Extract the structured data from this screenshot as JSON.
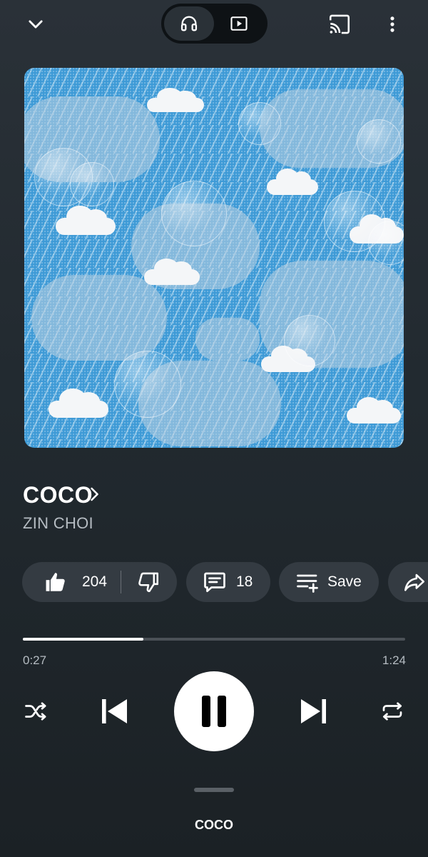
{
  "top_bar": {
    "minimize_icon": "chevron-down-icon",
    "mode_audio_icon": "headphones-icon",
    "mode_video_icon": "video-play-icon",
    "cast_icon": "cast-icon",
    "more_icon": "more-vertical-icon"
  },
  "song": {
    "title": "COCO",
    "artist": "ZIN CHOI"
  },
  "actions": {
    "like_count": "204",
    "comment_count": "18",
    "save_label": "Save"
  },
  "playback": {
    "elapsed": "0:27",
    "duration": "1:24",
    "progress_fraction": 0.315
  },
  "bottom_sheet": {
    "label": "COCO"
  },
  "colors": {
    "background": "#242b31",
    "chip": "#343b42",
    "accent": "#ffffff",
    "muted_text": "#b5bcc2"
  }
}
